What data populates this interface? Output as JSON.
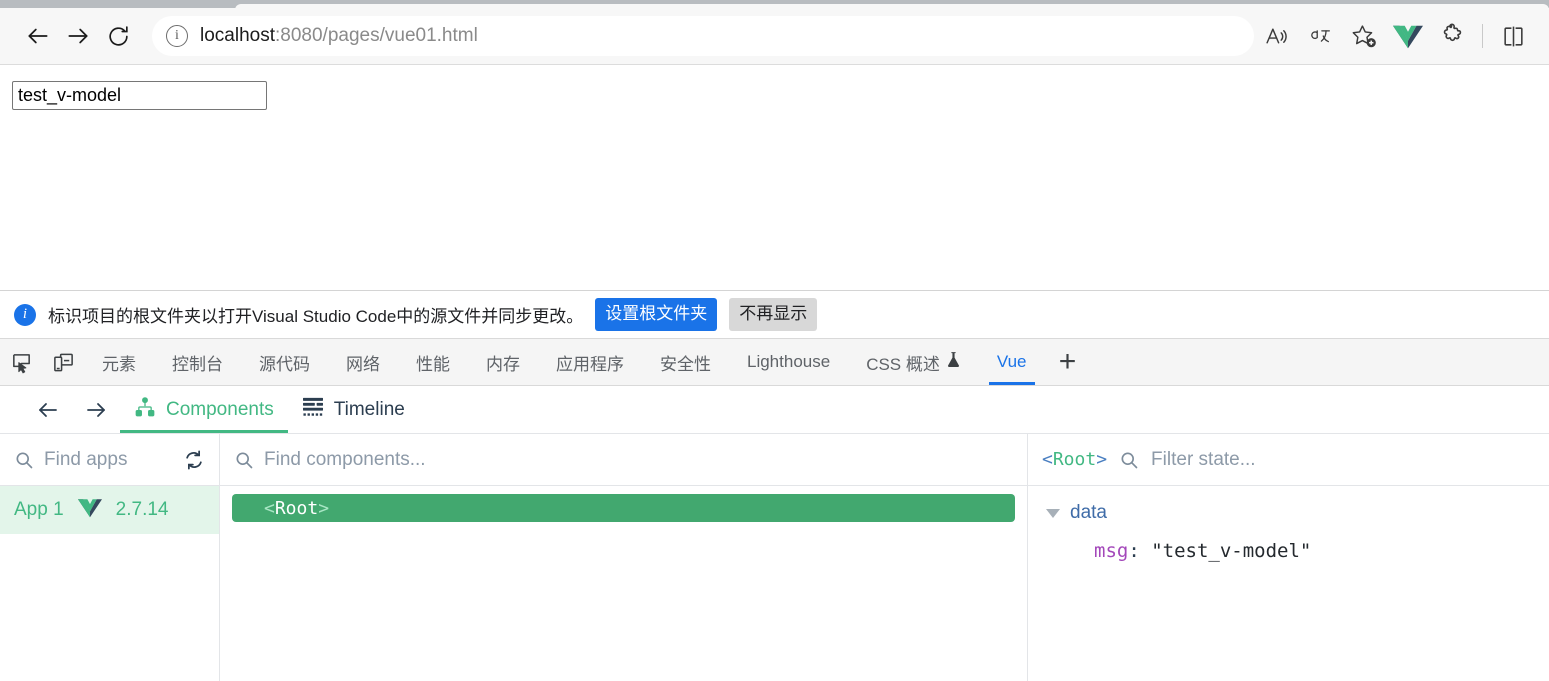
{
  "browser": {
    "back_label": "Back",
    "forward_label": "Forward",
    "reload_label": "Refresh",
    "site_info_label": "View site information",
    "url_host": "localhost",
    "url_path": ":8080/pages/vue01.html",
    "actions": [
      {
        "name": "read-aloud-icon",
        "label": "Read aloud"
      },
      {
        "name": "translate-icon",
        "label": "Translate"
      },
      {
        "name": "add-favorite-icon",
        "label": "Add this page to favorites"
      },
      {
        "name": "vue-devtools-icon",
        "label": "Vue.js devtools"
      },
      {
        "name": "extensions-icon",
        "label": "Extensions"
      },
      {
        "name": "split-screen-icon",
        "label": "Split screen"
      }
    ]
  },
  "page": {
    "input_value": "test_v-model",
    "input_placeholder": ""
  },
  "notice": {
    "message": "标识项目的根文件夹以打开Visual Studio Code中的源文件并同步更改。",
    "primary_button": "设置根文件夹",
    "secondary_button": "不再显示"
  },
  "devtools": {
    "inspect_label": "检查",
    "device_label": "设备模拟",
    "tabs": [
      {
        "label": "元素",
        "active": false
      },
      {
        "label": "控制台",
        "active": false
      },
      {
        "label": "源代码",
        "active": false
      },
      {
        "label": "网络",
        "active": false
      },
      {
        "label": "性能",
        "active": false
      },
      {
        "label": "内存",
        "active": false
      },
      {
        "label": "应用程序",
        "active": false
      },
      {
        "label": "安全性",
        "active": false
      },
      {
        "label": "Lighthouse",
        "active": false
      },
      {
        "label": "CSS 概述",
        "active": false
      },
      {
        "label": "Vue",
        "active": true
      }
    ],
    "more_tabs_label": "+",
    "active_tab": "Vue"
  },
  "vue": {
    "back_label": "Back",
    "forward_label": "Forward",
    "tabs": [
      {
        "label": "Components",
        "icon": "hierarchy-icon",
        "active": true
      },
      {
        "label": "Timeline",
        "icon": "timeline-icon",
        "active": false
      }
    ],
    "apps_panel": {
      "search_placeholder": "Find apps",
      "refresh_label": "Refresh",
      "apps": [
        {
          "name": "App 1",
          "version": "2.7.14",
          "selected": true
        }
      ]
    },
    "tree_panel": {
      "search_placeholder": "Find components...",
      "nodes": [
        {
          "open_bracket": "<",
          "name": "Root",
          "close_bracket": ">",
          "selected": true
        }
      ]
    },
    "state_panel": {
      "selected_open_bracket": "<",
      "selected_name": "Root",
      "selected_close_bracket": ">",
      "filter_placeholder": "Filter state...",
      "groups": [
        {
          "name": "data",
          "expanded": true,
          "entries": [
            {
              "key": "msg",
              "separator": ": ",
              "value": "\"test_v-model\""
            }
          ]
        }
      ]
    }
  },
  "colors": {
    "vue_green": "#42b883",
    "devtools_blue": "#1a73e8",
    "key_purple": "#a347ba"
  }
}
